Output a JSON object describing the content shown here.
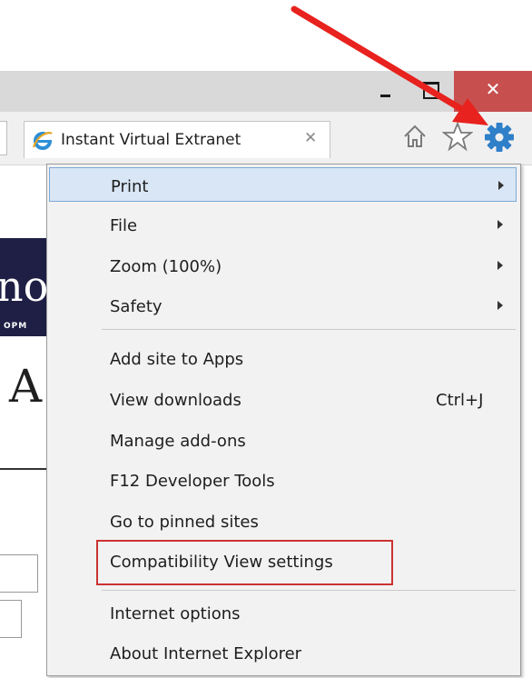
{
  "window": {
    "close_glyph": "✕"
  },
  "tab": {
    "title": "Instant Virtual Extranet",
    "close_glyph": "✕"
  },
  "toolbar": {
    "icons": [
      "home-icon",
      "favorites-star-icon",
      "tools-gear-icon"
    ]
  },
  "page": {
    "banner_text": "no",
    "banner_sub": "OPM",
    "letter": "A"
  },
  "menu": {
    "groups": [
      [
        {
          "label": "Print",
          "submenu": true,
          "highlighted": true
        },
        {
          "label": "File",
          "submenu": true
        },
        {
          "label": "Zoom (100%)",
          "submenu": true
        },
        {
          "label": "Safety",
          "submenu": true
        }
      ],
      [
        {
          "label": "Add site to Apps"
        },
        {
          "label": "View downloads",
          "shortcut": "Ctrl+J"
        },
        {
          "label": "Manage add-ons"
        },
        {
          "label": "F12 Developer Tools"
        },
        {
          "label": "Go to pinned sites"
        },
        {
          "label": "Compatibility View settings",
          "callout": true
        }
      ],
      [
        {
          "label": "Internet options"
        },
        {
          "label": "About Internet Explorer"
        }
      ]
    ]
  },
  "colors": {
    "annotation_red": "#e8221e",
    "close_button": "#c7504f",
    "highlight": "#d8e6f5",
    "gear_blue": "#2f7fc9"
  }
}
